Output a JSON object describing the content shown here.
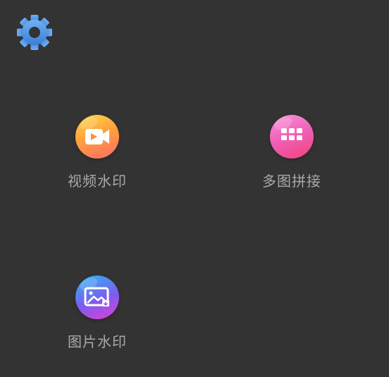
{
  "colors": {
    "background": "#333333",
    "label": "#a9a9a9",
    "settings_gear": "#4a8fe0"
  },
  "header": {
    "settings_icon": "gear-icon"
  },
  "features": [
    {
      "id": "video-watermark",
      "label": "视频水印",
      "icon": "video-camera-icon"
    },
    {
      "id": "multi-image-collage",
      "label": "多图拼接",
      "icon": "grid-icon"
    },
    {
      "id": "image-watermark",
      "label": "图片水印",
      "icon": "picture-icon"
    }
  ]
}
